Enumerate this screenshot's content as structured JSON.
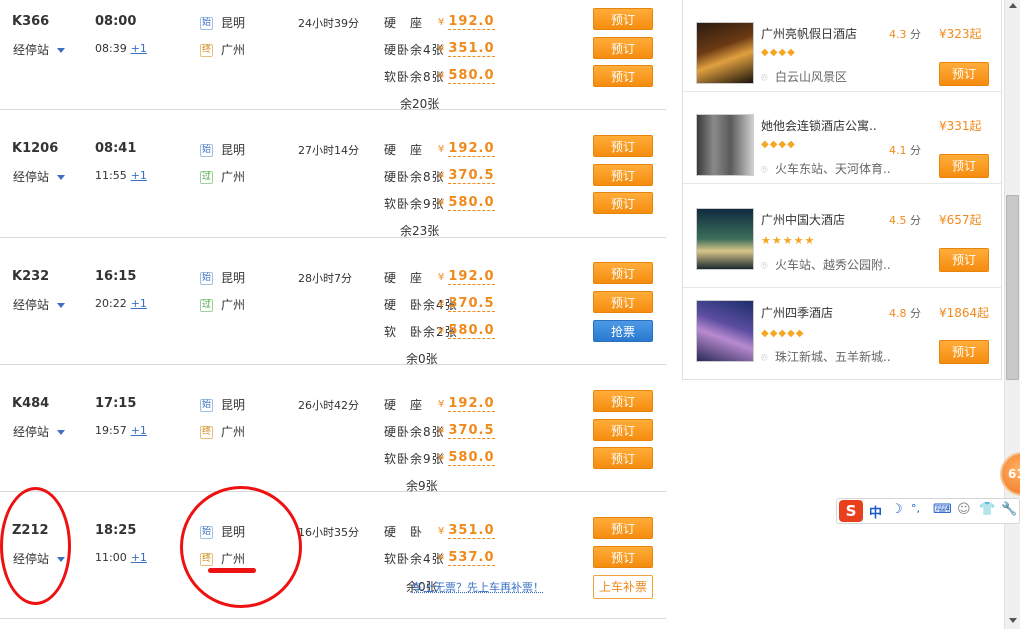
{
  "trains": [
    {
      "no": "K366",
      "via_label": "经停站",
      "dep_time": "08:00",
      "arr_time": "08:39",
      "day_plus": "+1",
      "from_tag": "始",
      "from": "昆明",
      "to_tag": "终",
      "to": "广州",
      "duration": "24小时39分",
      "seats": [
        {
          "type": "硬　座",
          "remain": "",
          "price": "192.0"
        },
        {
          "type": "硬卧",
          "remain": "余4张",
          "price": "351.0"
        },
        {
          "type": "软卧",
          "remain": "余8张",
          "price": "580.0"
        }
      ],
      "left_more": "余20张",
      "buttons": [
        "预订",
        "预订",
        "预订"
      ]
    },
    {
      "no": "K1206",
      "via_label": "经停站",
      "dep_time": "08:41",
      "arr_time": "11:55",
      "day_plus": "+1",
      "from_tag": "始",
      "from": "昆明",
      "to_tag": "过",
      "to": "广州",
      "duration": "27小时14分",
      "seats": [
        {
          "type": "硬　座",
          "remain": "",
          "price": "192.0"
        },
        {
          "type": "硬卧",
          "remain": "余8张",
          "price": "370.5"
        },
        {
          "type": "软卧",
          "remain": "余9张",
          "price": "580.0"
        }
      ],
      "left_more": "余23张",
      "buttons": [
        "预订",
        "预订",
        "预订"
      ]
    },
    {
      "no": "K232",
      "via_label": "经停站",
      "dep_time": "16:15",
      "arr_time": "20:22",
      "day_plus": "+1",
      "from_tag": "始",
      "from": "昆明",
      "to_tag": "过",
      "to": "广州",
      "duration": "28小时7分",
      "seats": [
        {
          "type": "硬　座",
          "remain": "",
          "price": "192.0"
        },
        {
          "type": "硬　卧",
          "remain": "余4张",
          "price": "370.5"
        },
        {
          "type": "软　卧",
          "remain": "余2张",
          "price": "580.0"
        }
      ],
      "left_more": "余0张",
      "buttons": [
        "预订",
        "预订",
        "抢票"
      ]
    },
    {
      "no": "K484",
      "via_label": "经停站",
      "dep_time": "17:15",
      "arr_time": "19:57",
      "day_plus": "+1",
      "from_tag": "始",
      "from": "昆明",
      "to_tag": "终",
      "to": "广州",
      "duration": "26小时42分",
      "seats": [
        {
          "type": "硬　座",
          "remain": "",
          "price": "192.0"
        },
        {
          "type": "硬卧",
          "remain": "余8张",
          "price": "370.5"
        },
        {
          "type": "软卧",
          "remain": "余9张",
          "price": "580.0"
        }
      ],
      "left_more": "余9张",
      "buttons": [
        "预订",
        "预订",
        "预订"
      ]
    },
    {
      "no": "Z212",
      "via_label": "经停站",
      "dep_time": "18:25",
      "arr_time": "11:00",
      "day_plus": "+1",
      "from_tag": "始",
      "from": "昆明",
      "to_tag": "终",
      "to": "广州",
      "duration": "16小时35分",
      "seats": [
        {
          "type": "硬　卧",
          "remain": "",
          "price": "351.0"
        },
        {
          "type": "软卧",
          "remain": "余4张",
          "price": "537.0"
        }
      ],
      "left_more": "余0张",
      "notice": "车上无票？先上车再补票！",
      "buttons": [
        "预订",
        "预订",
        "上车补票"
      ]
    }
  ],
  "currency": "¥",
  "hotels": [
    {
      "name": "广州亮帆假日酒店",
      "score": "4.3",
      "score_unit": "分",
      "price": "¥323起",
      "stars": "◆◆◆◆",
      "location": "白云山风景区",
      "button": "预订"
    },
    {
      "name": "她他会连锁酒店公寓..",
      "score": "4.1",
      "score_unit": "分",
      "price": "¥331起",
      "stars": "◆◆◆◆",
      "location": "火车东站、天河体育..",
      "button": "预订"
    },
    {
      "name": "广州中国大酒店",
      "score": "4.5",
      "score_unit": "分",
      "price": "¥657起",
      "stars": "★★★★★",
      "location": "火车站、越秀公园附..",
      "button": "预订"
    },
    {
      "name": "广州四季酒店",
      "score": "4.8",
      "score_unit": "分",
      "price": "¥1864起",
      "stars": "◆◆◆◆◆",
      "location": "珠江新城、五羊新城..",
      "button": "预订"
    }
  ],
  "float_badge": "61",
  "ime": {
    "logo": "S",
    "mode": "中",
    "moon": "☽",
    "punct": "°,",
    "keyboard": "⌨",
    "user": "☺",
    "shirt": "👕",
    "wrench": "🔧"
  },
  "colors": {
    "accent": "#f08a1c",
    "button": "#ff9a1e",
    "grab": "#2a79cf",
    "annotation": "#e11111"
  }
}
